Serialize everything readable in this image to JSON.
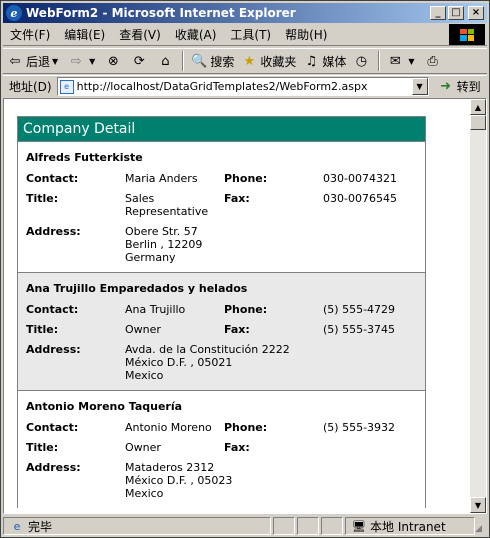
{
  "window": {
    "title": "WebForm2 - Microsoft Internet Explorer",
    "minimize": "_",
    "maximize": "□",
    "close": "×"
  },
  "menu": [
    "文件(F)",
    "编辑(E)",
    "查看(V)",
    "收藏(A)",
    "工具(T)",
    "帮助(H)"
  ],
  "toolbar": {
    "back": "后退",
    "forward": "",
    "stop": "",
    "refresh": "",
    "home": "",
    "search": "搜索",
    "favorites": "收藏夹",
    "media": "媒体"
  },
  "address": {
    "label": "地址(D)",
    "url": "http://localhost/DataGridTemplates2/WebForm2.aspx",
    "go": "转到"
  },
  "grid": {
    "header": "Company Detail",
    "labels": {
      "contact": "Contact:",
      "phone": "Phone:",
      "title": "Title:",
      "fax": "Fax:",
      "address": "Address:"
    },
    "records": [
      {
        "company": "Alfreds Futterkiste",
        "contact": "Maria Anders",
        "phone": "030-0074321",
        "title": "Sales\nRepresentative",
        "fax": "030-0076545",
        "address": "Obere Str. 57\nBerlin , 12209\nGermany"
      },
      {
        "company": "Ana Trujillo Emparedados y helados",
        "contact": "Ana Trujillo",
        "phone": "(5) 555-4729",
        "title": "Owner",
        "fax": "(5) 555-3745",
        "address": "Avda. de la Constitución 2222\nMéxico D.F. , 05021\nMexico"
      },
      {
        "company": "Antonio Moreno Taquería",
        "contact": "Antonio Moreno",
        "phone": "(5) 555-3932",
        "title": "Owner",
        "fax": "",
        "address": "Mataderos 2312\nMéxico D.F. , 05023\nMexico"
      }
    ]
  },
  "status": {
    "text": "完毕",
    "zone": "本地 Intranet"
  }
}
